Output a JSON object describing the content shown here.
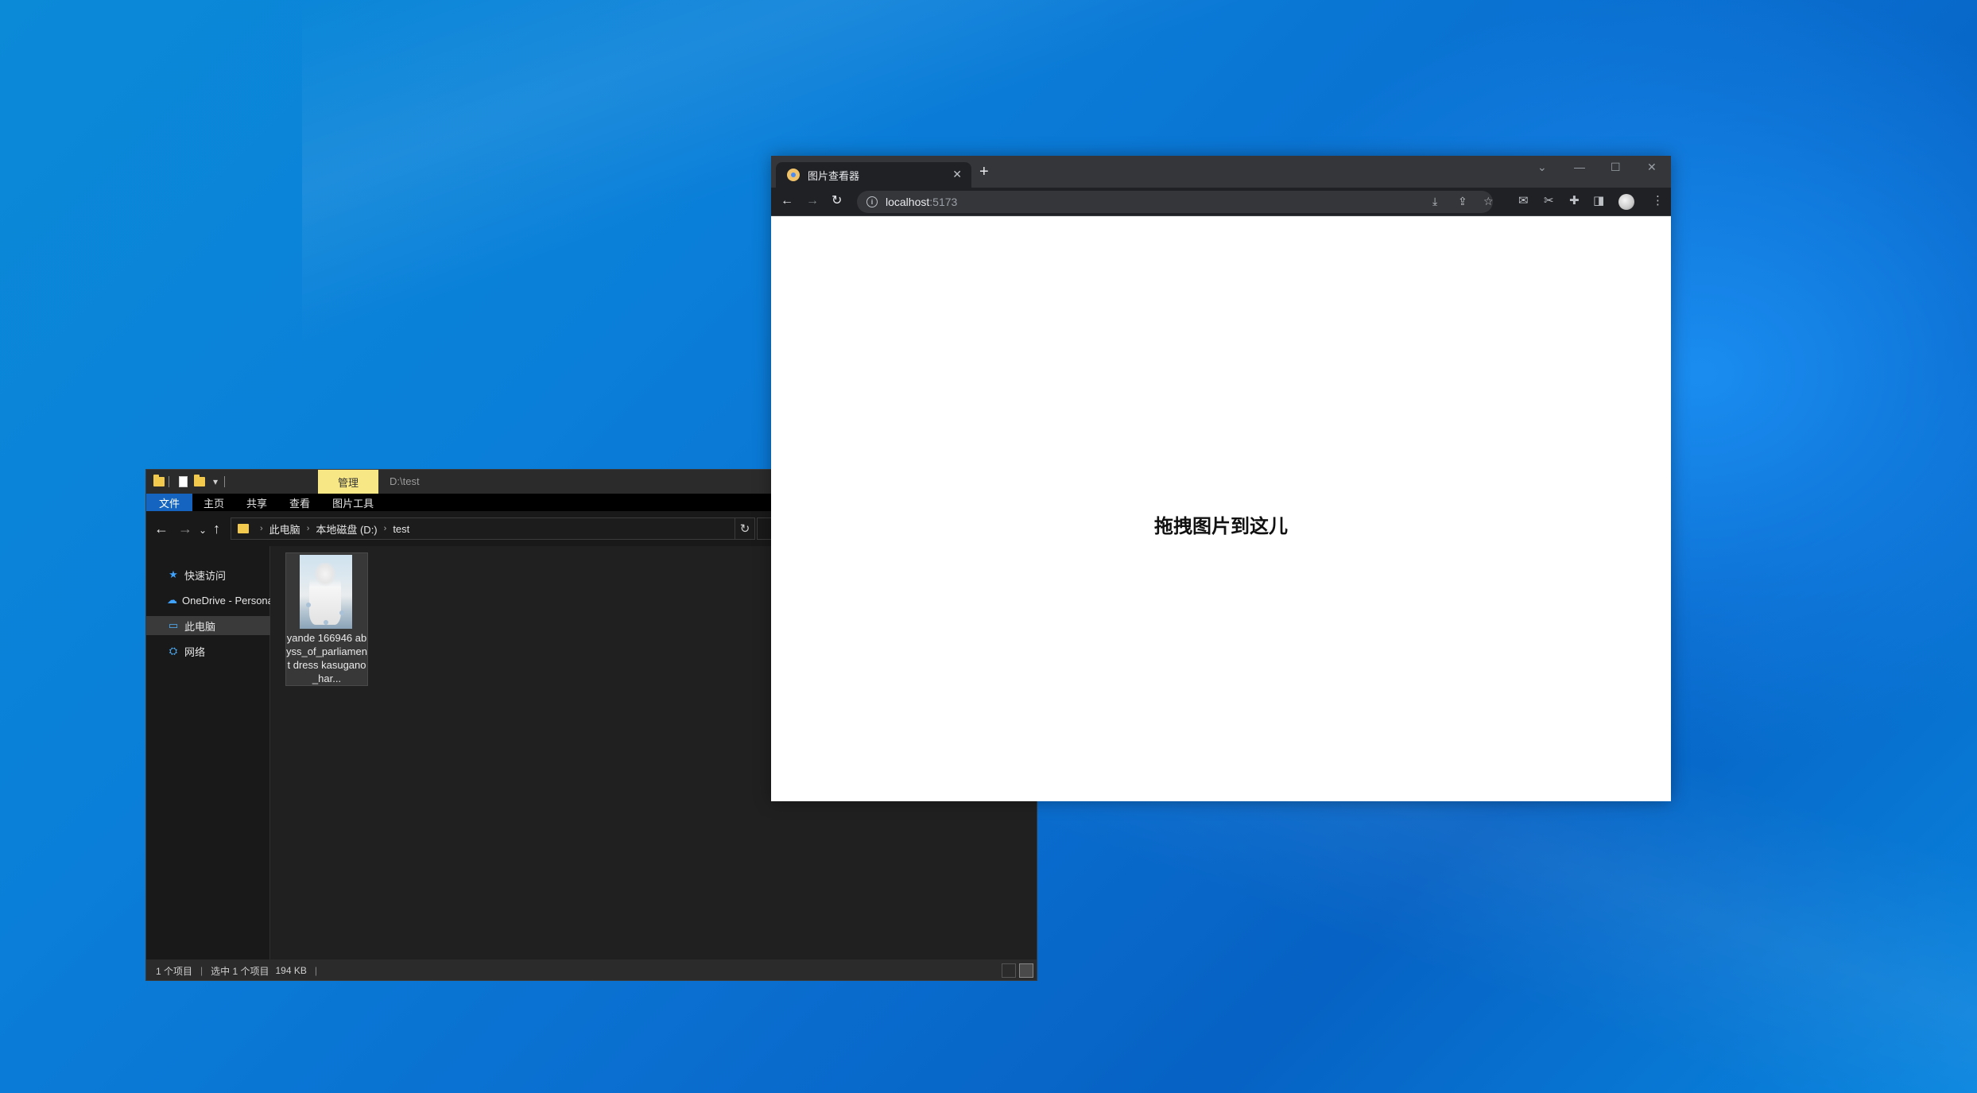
{
  "desktop": {},
  "explorer": {
    "ribbon_context_tab": "管理",
    "title_path": "D:\\test",
    "ribbon_tabs": [
      "文件",
      "主页",
      "共享",
      "查看",
      "图片工具"
    ],
    "breadcrumb": [
      "此电脑",
      "本地磁盘 (D:)",
      "test"
    ],
    "sidebar": [
      {
        "label": "快速访问",
        "icon": "star-icon"
      },
      {
        "label": "OneDrive - Persona",
        "icon": "cloud-icon"
      },
      {
        "label": "此电脑",
        "icon": "computer-icon",
        "selected": true
      },
      {
        "label": "网络",
        "icon": "network-icon"
      }
    ],
    "files": [
      {
        "name": "yande 166946 abyss_of_parliament dress kasugano_har...",
        "selected": true
      }
    ],
    "status": {
      "count": "1 个项目",
      "selected": "选中 1 个项目",
      "size": "194 KB"
    }
  },
  "browser": {
    "tab_title": "图片查看器",
    "url_host": "localhost",
    "url_port": ":5173",
    "page": {
      "drop_hint": "拖拽图片到这儿"
    }
  }
}
